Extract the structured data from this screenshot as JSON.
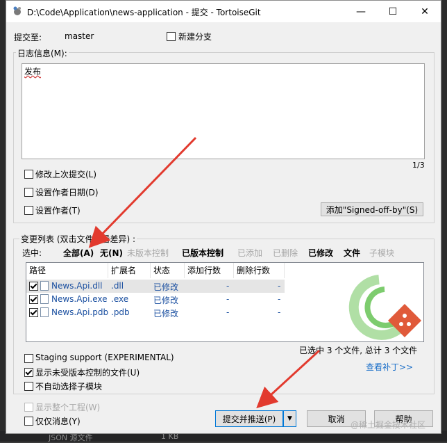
{
  "window": {
    "title": "D:\\Code\\Application\\news-application - 提交 - TortoiseGit",
    "minimize": "—",
    "maximize": "☐",
    "close": "✕"
  },
  "commit_to": {
    "label": "提交至:",
    "branch": "master",
    "new_branch": "新建分支"
  },
  "log": {
    "label": "日志信息(M):",
    "message": "发布",
    "line_count": "1/3",
    "amend": "修改上次提交(L)",
    "set_date": "设置作者日期(D)",
    "set_author": "设置作者(T)",
    "signed_off": "添加\"Signed-off-by\"(S)"
  },
  "changes": {
    "label": "变更列表 (双击文件查看差异) :",
    "select_label": "选中:",
    "filters": [
      {
        "label": "全部(A)",
        "state": "bold"
      },
      {
        "label": "无(N)",
        "state": "bold"
      },
      {
        "label": "未版本控制",
        "state": "gray"
      },
      {
        "label": "已版本控制",
        "state": "bold"
      },
      {
        "label": "已添加",
        "state": "gray"
      },
      {
        "label": "已删除",
        "state": "gray"
      },
      {
        "label": "已修改",
        "state": "bold"
      },
      {
        "label": "文件",
        "state": "bold"
      },
      {
        "label": "子模块",
        "state": "gray"
      }
    ],
    "columns": [
      "路径",
      "扩展名",
      "状态",
      "添加行数",
      "删除行数"
    ],
    "files": [
      {
        "path": "News.Api.dll",
        "ext": ".dll",
        "status": "已修改",
        "added": "-",
        "deleted": "-",
        "selected": true
      },
      {
        "path": "News.Api.exe",
        "ext": ".exe",
        "status": "已修改",
        "added": "-",
        "deleted": "-",
        "selected": false
      },
      {
        "path": "News.Api.pdb",
        "ext": ".pdb",
        "status": "已修改",
        "added": "-",
        "deleted": "-",
        "selected": false
      }
    ],
    "summary": "已选中 3 个文件, 总计 3 个文件",
    "view_patch": "查看补丁>>"
  },
  "options": {
    "staging": "Staging support (EXPERIMENTAL)",
    "show_unversioned": "显示未受版本控制的文件(U)",
    "no_auto_submodule": "不自动选择子模块",
    "show_whole_project": "显示整个工程(W)",
    "message_only": "仅仅消息(Y)"
  },
  "buttons": {
    "commit_push": "提交并推送(P)",
    "cancel": "取消",
    "help": "帮助"
  },
  "background": {
    "bottom_left": "JSON 源文件",
    "bottom_mid": "1 KB",
    "watermark": "@稀土掘金技术社区"
  },
  "colors": {
    "accent": "#0078d7",
    "arrow": "#e23a2e",
    "link": "#1a6ec8",
    "logo_green": "#5cbf4a"
  }
}
